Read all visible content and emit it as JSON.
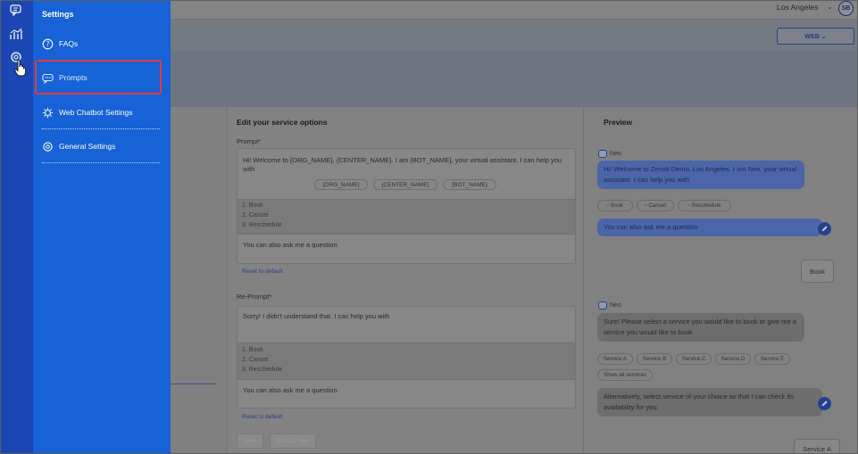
{
  "rail": {
    "icons": [
      "chat-icon",
      "analytics-icon",
      "settings-icon"
    ]
  },
  "drawer": {
    "title": "Settings",
    "items": [
      {
        "label": "FAQs",
        "icon": "question-circle-icon"
      },
      {
        "label": "Prompts",
        "icon": "chat-bubbles-icon",
        "highlighted": true
      },
      {
        "label": "Web Chatbot Settings",
        "icon": "gear-cog-icon"
      },
      {
        "label": "General Settings",
        "icon": "gear-icon"
      }
    ],
    "highlight_color": "#e53935"
  },
  "header": {
    "location": "Los Angeles",
    "avatar_initials": "SB",
    "channel_button": "WEB ⌄"
  },
  "edit": {
    "heading": "Edit your service options",
    "prompt_label": "Prompt*",
    "prompt_text": "Hi! Welcome to {ORG_NAME}, {CENTER_NAME}. I am {BOT_NAME}, your virtual assistant. I can help you with",
    "placeholders": [
      "{ORG_NAME}",
      "{CENTER_NAME}",
      "{BOT_NAME}"
    ],
    "prompt_options": [
      "1. Book",
      "2. Cancel",
      "3. Reschedule"
    ],
    "prompt_footer": "You can also ask me a question",
    "reset_label": "Reset to default",
    "reprompt_label": "Re-Prompt*",
    "reprompt_text": "Sorry! I didn't understand that. I can help you with",
    "reprompt_options": [
      "1. Book",
      "2. Cancel",
      "3. Reschedule"
    ],
    "reprompt_footer": "You can also ask me a question",
    "reset2_label": "Reset to default",
    "save_label": "Save",
    "save_new_label": "Save & New"
  },
  "preview": {
    "heading": "Preview",
    "bot_name": "Neo",
    "bubble1": "Hi! Welcome to Zenoti Demo, Los Angeles. I am Neo, your virtual assistant. I can help you with",
    "quick_replies": [
      "Book",
      "Cancel",
      "Reschedule"
    ],
    "bubble2": "You can also ask me a question",
    "user_reply": "Book",
    "bot_name2": "Neo",
    "bubble3": "Sure! Please select a service you would like to book or give me a service you would like to book",
    "services": [
      "Service A",
      "Service B",
      "Service C",
      "Service D",
      "Service E"
    ],
    "show_all": "Show all services",
    "bubble4": "Alternatively, select service of your choice so that I can check its availability for you.",
    "user_reply2": "Service A"
  },
  "colors": {
    "rail": "#1b47b5",
    "drawer": "#1662d6",
    "overlay_page": "#7f7f7f"
  }
}
